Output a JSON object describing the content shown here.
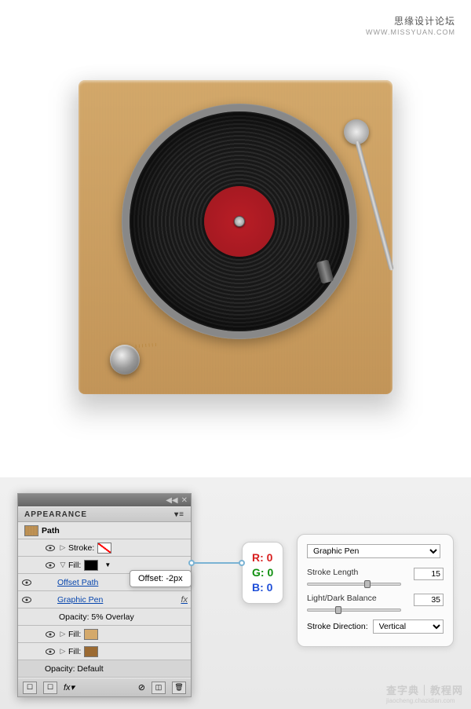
{
  "header": {
    "title": "思缘设计论坛",
    "url": "WWW.MISSYUAN.COM"
  },
  "appearance": {
    "title": "APPEARANCE",
    "object_label": "Path",
    "stroke_label": "Stroke:",
    "fill_label": "Fill:",
    "offset_path_label": "Offset Path",
    "graphic_pen_row_label": "Graphic Pen",
    "opacity_overlay_label": "Opacity:  5% Overlay",
    "opacity_default_label": "Opacity:  Default"
  },
  "tooltip": {
    "offset_value": "Offset: -2px"
  },
  "rgb": {
    "r": "R: 0",
    "g": "G: 0",
    "b": "B: 0"
  },
  "settings": {
    "effect_name": "Graphic Pen",
    "stroke_length_label": "Stroke Length",
    "stroke_length_value": "15",
    "light_dark_label": "Light/Dark Balance",
    "light_dark_value": "35",
    "stroke_direction_label": "Stroke Direction:",
    "stroke_direction_value": "Vertical"
  },
  "slider_positions": {
    "stroke_length_px": "72",
    "light_dark_px": "35"
  },
  "watermark": {
    "main": "查字典｜教程网",
    "sub": "jiaocheng.chazidian.com"
  }
}
